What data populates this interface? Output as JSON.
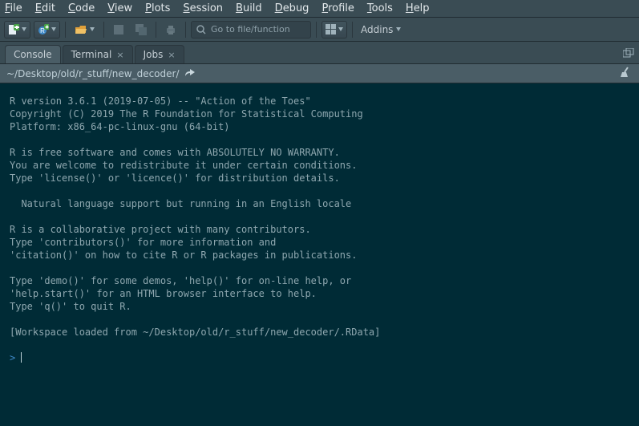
{
  "menu": {
    "items": [
      {
        "hot": "F",
        "rest": "ile"
      },
      {
        "hot": "E",
        "rest": "dit"
      },
      {
        "hot": "C",
        "rest": "ode"
      },
      {
        "hot": "V",
        "rest": "iew"
      },
      {
        "hot": "P",
        "rest": "lots"
      },
      {
        "hot": "S",
        "rest": "ession"
      },
      {
        "hot": "B",
        "rest": "uild"
      },
      {
        "hot": "D",
        "rest": "ebug"
      },
      {
        "hot": "P",
        "rest": "rofile"
      },
      {
        "hot": "T",
        "rest": "ools"
      },
      {
        "hot": "H",
        "rest": "elp"
      }
    ]
  },
  "toolbar": {
    "goto_placeholder": "Go to file/function",
    "addins_label": "Addins"
  },
  "tabs": {
    "console": "Console",
    "terminal": "Terminal",
    "jobs": "Jobs"
  },
  "pathbar": {
    "path": "~/Desktop/old/r_stuff/new_decoder/"
  },
  "console": {
    "text": "R version 3.6.1 (2019-07-05) -- \"Action of the Toes\"\nCopyright (C) 2019 The R Foundation for Statistical Computing\nPlatform: x86_64-pc-linux-gnu (64-bit)\n\nR is free software and comes with ABSOLUTELY NO WARRANTY.\nYou are welcome to redistribute it under certain conditions.\nType 'license()' or 'licence()' for distribution details.\n\n  Natural language support but running in an English locale\n\nR is a collaborative project with many contributors.\nType 'contributors()' for more information and\n'citation()' on how to cite R or R packages in publications.\n\nType 'demo()' for some demos, 'help()' for on-line help, or\n'help.start()' for an HTML browser interface to help.\nType 'q()' to quit R.\n\n[Workspace loaded from ~/Desktop/old/r_stuff/new_decoder/.RData]\n",
    "prompt": ">"
  }
}
